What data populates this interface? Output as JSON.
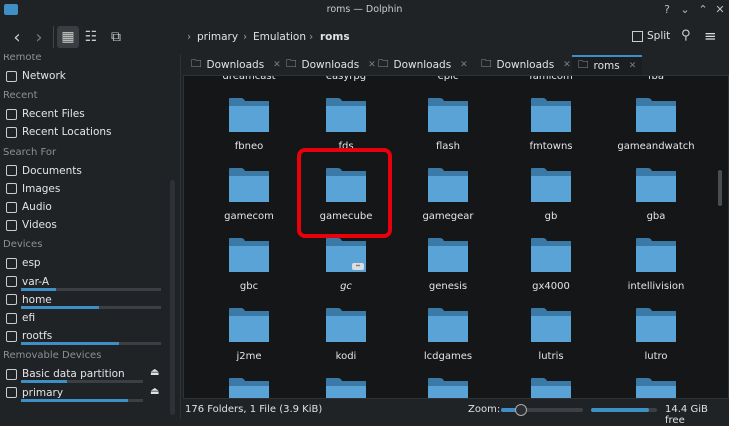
{
  "window": {
    "title": "roms — Dolphin",
    "help": "?",
    "minimize": "⌄",
    "maximize": "⌃",
    "close": "✕"
  },
  "toolbar": {
    "back": "‹",
    "forward": "›",
    "breadcrumb": [
      "primary",
      "Emulation",
      "roms"
    ],
    "split_label": "Split"
  },
  "sidebar": {
    "sections": [
      {
        "title": "Remote",
        "items": [
          {
            "label": "Network",
            "icon": "network-icon"
          }
        ]
      },
      {
        "title": "Recent",
        "items": [
          {
            "label": "Recent Files",
            "icon": "recent-files-icon"
          },
          {
            "label": "Recent Locations",
            "icon": "recent-locations-icon"
          }
        ]
      },
      {
        "title": "Search For",
        "items": [
          {
            "label": "Documents",
            "icon": "documents-icon"
          },
          {
            "label": "Images",
            "icon": "images-icon"
          },
          {
            "label": "Audio",
            "icon": "audio-icon"
          },
          {
            "label": "Videos",
            "icon": "videos-icon"
          }
        ]
      },
      {
        "title": "Devices",
        "items": [
          {
            "label": "esp",
            "icon": "drive-icon"
          },
          {
            "label": "var-A",
            "icon": "drive-icon",
            "usage": 0.25
          },
          {
            "label": "home",
            "icon": "drive-icon",
            "usage": 0.56
          },
          {
            "label": "efi",
            "icon": "drive-icon"
          },
          {
            "label": "rootfs",
            "icon": "drive-icon",
            "usage": 0.7
          }
        ]
      },
      {
        "title": "Removable Devices",
        "items": [
          {
            "label": "Basic data partition",
            "icon": "usb-drive-icon",
            "usage": 0.38,
            "eject": "⏏"
          },
          {
            "label": "primary",
            "icon": "sd-card-icon",
            "usage": 0.88,
            "eject": "⏏"
          }
        ]
      }
    ]
  },
  "tabs": [
    {
      "label": "Downloads"
    },
    {
      "label": "Downloads"
    },
    {
      "label": "Downloads"
    },
    {
      "label": "Downloads"
    },
    {
      "label": "roms",
      "active": true
    }
  ],
  "files": [
    "dreamcast",
    "easyrpg",
    "epic",
    "famicom",
    "fba",
    "fbneo",
    "fds",
    "flash",
    "fmtowns",
    "gameandwatch",
    "gamecom",
    "gamecube",
    "gamegear",
    "gb",
    "gba",
    "gbc",
    "gc",
    "genesis",
    "gx4000",
    "intellivision",
    "j2me",
    "kodi",
    "lcdgames",
    "lutris",
    "lutro",
    "",
    "",
    "",
    "",
    ""
  ],
  "symlink_file": "gc",
  "selected_highlight": "gamecube",
  "status": {
    "summary": "176 Folders, 1 File (3.9 KiB)",
    "zoom_label": "Zoom:",
    "zoom_level": 0.2,
    "free_label": "14.4 GiB free",
    "disk_used": 0.88
  },
  "colors": {
    "accent": "#3d8fc6",
    "folder": "#5aa3d6",
    "highlight": "#e8000b"
  }
}
